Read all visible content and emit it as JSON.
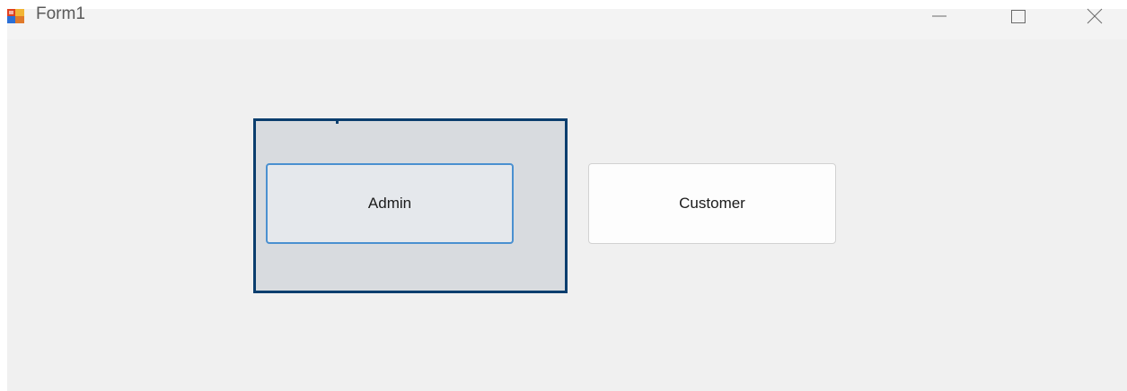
{
  "window": {
    "title": "Form1"
  },
  "form": {
    "admin_label": "Admin",
    "customer_label": "Customer"
  },
  "icons": {
    "app": "form-app-icon",
    "minimize": "minimize-icon",
    "maximize": "maximize-icon",
    "close": "close-icon"
  },
  "colors": {
    "panel_border": "#0b3e6e",
    "focused_button_border": "#4a90d0"
  }
}
